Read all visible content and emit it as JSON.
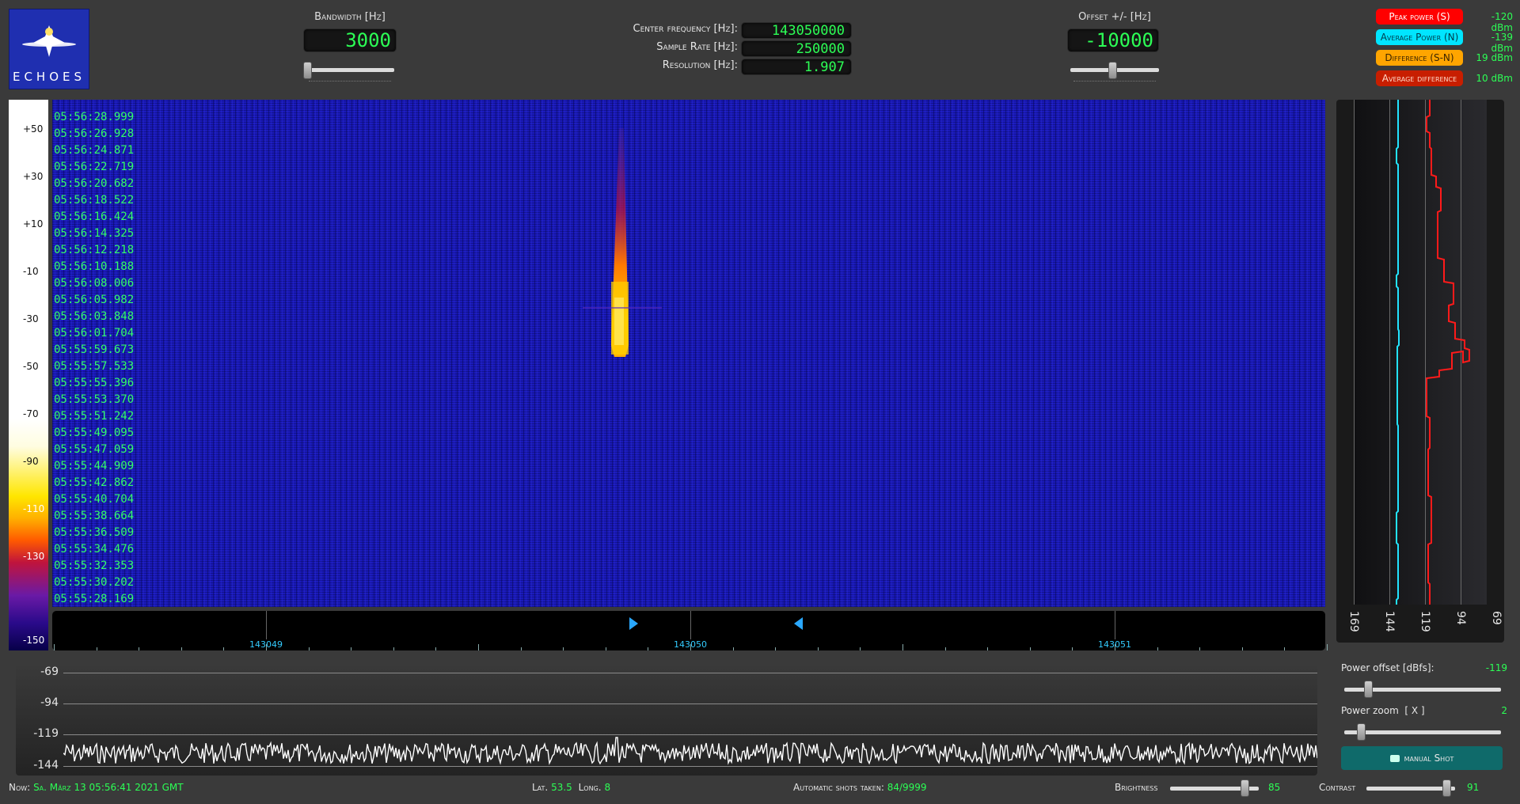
{
  "app": {
    "logo_text": "ECHOES"
  },
  "controls": {
    "bandwidth": {
      "label": "Bandwidth [Hz]",
      "value": "3000",
      "slider_level": 0.02
    },
    "center_frequency": {
      "label": "Center frequency [Hz]:",
      "value": "143050000"
    },
    "sample_rate": {
      "label": "Sample Rate [Hz]:",
      "value": "250000"
    },
    "resolution": {
      "label": "Resolution [Hz]:",
      "value": "1.907"
    },
    "offset": {
      "label": "Offset +/- [Hz]",
      "value": "-10000",
      "slider_level": 0.47
    }
  },
  "legend": [
    {
      "label": "Peak power (S)",
      "value": "-120 dBm",
      "bg": "#ff0000",
      "fg": "#ffffff"
    },
    {
      "label": "Average Power (N)",
      "value": "-139 dBm",
      "bg": "#00e5ff",
      "fg": "#003a48"
    },
    {
      "label": "Difference (S-N)",
      "value": "19 dBm",
      "bg": "#ffa500",
      "fg": "#3a2400"
    },
    {
      "label": "Average difference",
      "value": "10 dBm",
      "bg": "#c81e00",
      "fg": "#ffd9c9"
    }
  ],
  "colorbar": {
    "labels": [
      "+50",
      "+30",
      "+10",
      "-10",
      "-30",
      "-50",
      "-70",
      "-90",
      "-110",
      "-130",
      "-150"
    ]
  },
  "waterfall": {
    "timestamps": [
      "05:56:28.999",
      "05:56:26.928",
      "05:56:24.871",
      "05:56:22.719",
      "05:56:20.682",
      "05:56:18.522",
      "05:56:16.424",
      "05:56:14.325",
      "05:56:12.218",
      "05:56:10.188",
      "05:56:08.006",
      "05:56:05.982",
      "05:56:03.848",
      "05:56:01.704",
      "05:55:59.673",
      "05:55:57.533",
      "05:55:55.396",
      "05:55:53.370",
      "05:55:51.242",
      "05:55:49.095",
      "05:55:47.059",
      "05:55:44.909",
      "05:55:42.862",
      "05:55:40.704",
      "05:55:38.664",
      "05:55:36.509",
      "05:55:34.476",
      "05:55:32.353",
      "05:55:30.202",
      "05:55:28.169"
    ]
  },
  "freq_axis": {
    "labels": [
      "143049",
      "143050",
      "143051"
    ]
  },
  "power_panel": {
    "scale_labels": [
      "169",
      "144",
      "119",
      "94",
      "69"
    ]
  },
  "spectrum": {
    "scale_labels": [
      "-69",
      "-94",
      "-119",
      "-144"
    ]
  },
  "settings": {
    "power_offset": {
      "label": "Power offset [dBfs]:",
      "value": "-119"
    },
    "power_zoom": {
      "label": "Power zoom  [ X ]",
      "value": "2"
    },
    "manual_shot": "manual Shot"
  },
  "status": {
    "now_label": "Now:",
    "now_value": "Sa. März 13 05:56:41 2021 GMT",
    "lat_label": "Lat.",
    "lat_value": "53.5",
    "long_label": "Long.",
    "long_value": "8",
    "shots_label": "Automatic shots taken:",
    "shots_value": "84/9999",
    "brightness_label": "Brightness",
    "brightness_value": "85",
    "contrast_label": "Contrast",
    "contrast_value": "91"
  }
}
